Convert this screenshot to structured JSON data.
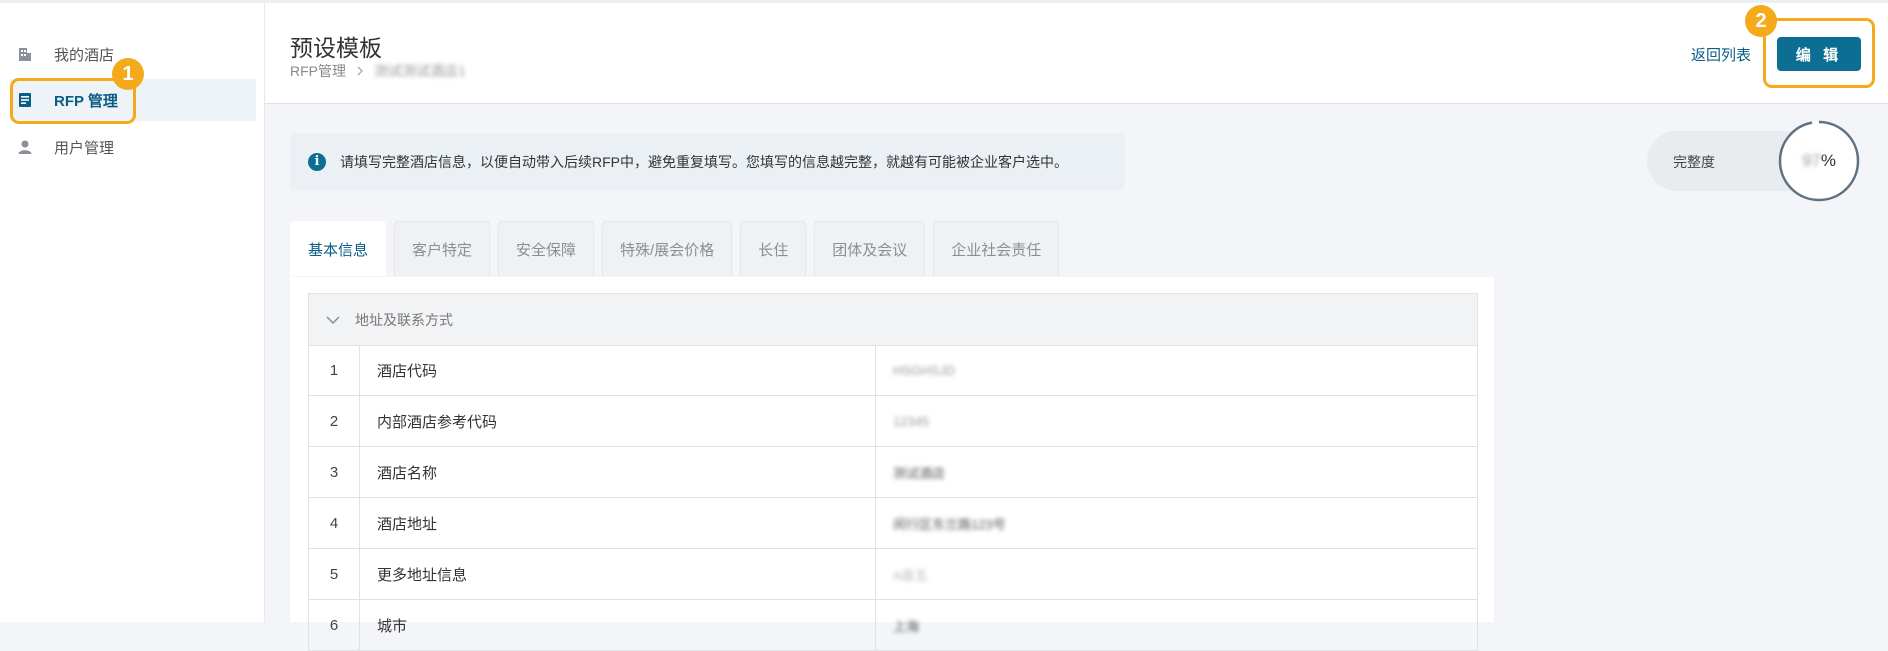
{
  "sidebar": {
    "items": [
      {
        "label": "我的酒店",
        "icon": "building-icon"
      },
      {
        "label": "RFP 管理",
        "icon": "document-icon"
      },
      {
        "label": "用户管理",
        "icon": "user-icon"
      }
    ]
  },
  "header": {
    "title": "预设模板",
    "breadcrumb": {
      "root": "RFP管理",
      "current": "测试测试酒店1"
    },
    "back_label": "返回列表",
    "edit_label": "编 辑"
  },
  "callouts": [
    "1",
    "2"
  ],
  "info": {
    "text": "请填写完整酒店信息，以便自动带入后续RFP中，避免重复填写。您填写的信息越完整，就越有可能被企业客户选中。"
  },
  "completeness": {
    "label": "完整度",
    "value": "97",
    "unit": "%",
    "fraction": 0.97
  },
  "tabs": [
    "基本信息",
    "客户特定",
    "安全保障",
    "特殊/展会价格",
    "长住",
    "团体及会议",
    "企业社会责任"
  ],
  "section": {
    "title": "地址及联系方式"
  },
  "rows": [
    {
      "index": "1",
      "name": "酒店代码",
      "value": "HSGHSJD"
    },
    {
      "index": "2",
      "name": "内部酒店参考代码",
      "value": "12345"
    },
    {
      "index": "3",
      "name": "酒店名称",
      "value": "测试酒店"
    },
    {
      "index": "4",
      "name": "酒店地址",
      "value": "闵行区东兰路123号"
    },
    {
      "index": "5",
      "name": "更多地址信息",
      "value": "A座五"
    },
    {
      "index": "6",
      "name": "城市",
      "value": "上海"
    }
  ],
  "colors": {
    "accent": "#0d6e93",
    "callout": "#f5aa1c"
  }
}
